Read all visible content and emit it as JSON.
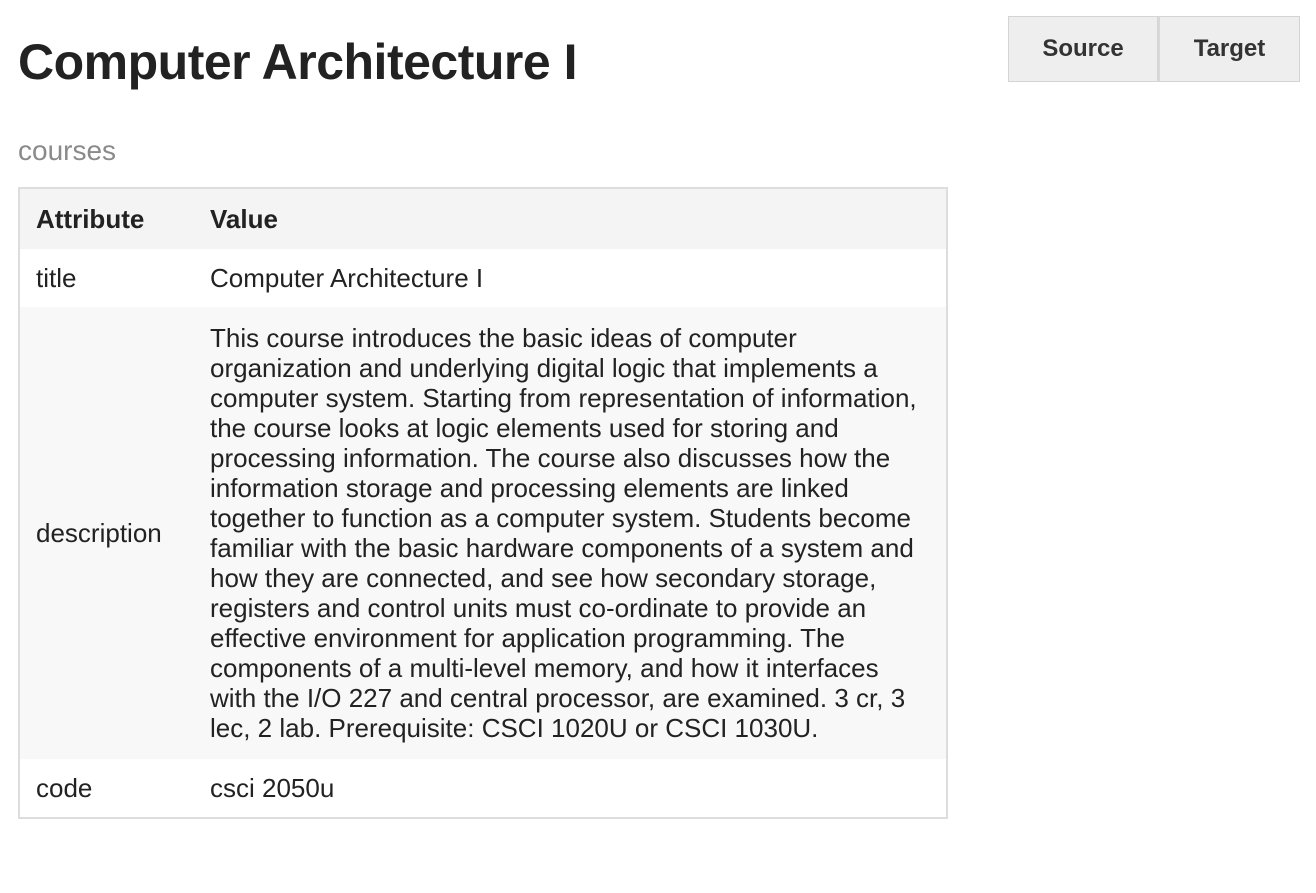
{
  "header": {
    "title": "Computer Architecture I",
    "subtitle": "courses"
  },
  "toolbar": {
    "source_label": "Source",
    "target_label": "Target"
  },
  "table": {
    "headers": {
      "attribute": "Attribute",
      "value": "Value"
    },
    "rows": [
      {
        "attribute": "title",
        "value": "Computer Architecture I"
      },
      {
        "attribute": "description",
        "value": "This course introduces the basic ideas of computer organization and underlying digital logic that implements a computer system. Starting from representation of information, the course looks at logic elements used for storing and processing information. The course also discusses how the information storage and processing elements are linked together to function as a computer system. Students become familiar with the basic hardware components of a system and how they are connected, and see how secondary storage, registers and control units must co-ordinate to provide an effective environment for application programming. The components of a multi-level memory, and how it interfaces with the I/O 227 and central processor, are examined. 3 cr, 3 lec, 2 lab. Prerequisite: CSCI 1020U or CSCI 1030U."
      },
      {
        "attribute": "code",
        "value": "csci 2050u"
      }
    ]
  }
}
